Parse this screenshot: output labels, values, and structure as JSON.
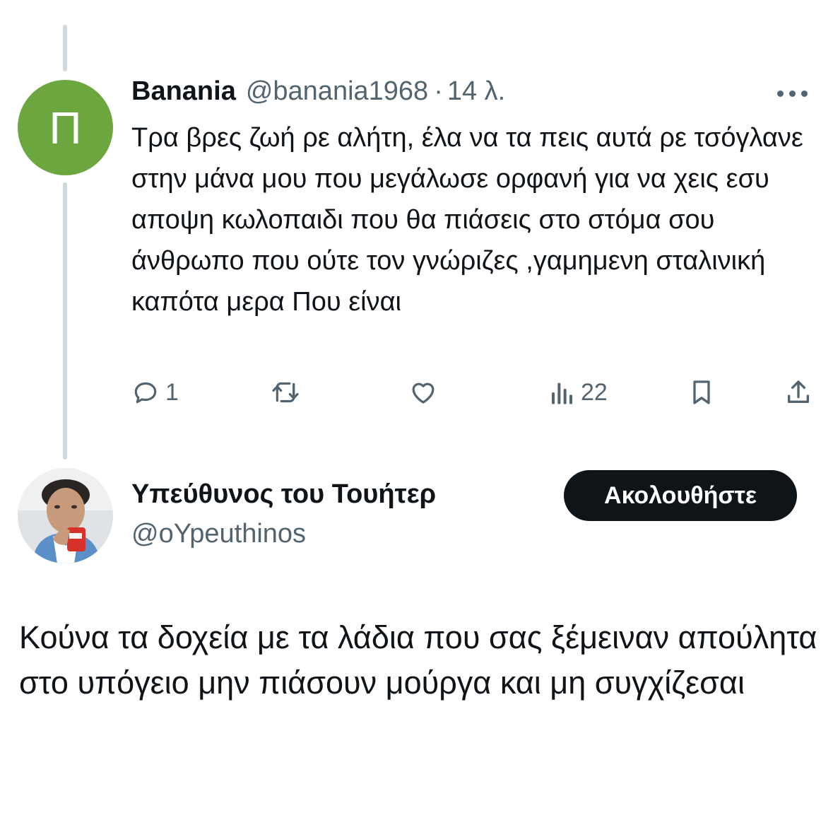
{
  "reply": {
    "avatar_letter": "Π",
    "name": "Banania",
    "handle": "@banania1968",
    "separator": "·",
    "time": "14 λ.",
    "text": "Τρα βρες ζωή ρε αλήτη, έλα να τα πεις αυτά ρε τσόγλανε στην μάνα μου που μεγάλωσε ορφανή για να χεις εσυ αποψη κωλοπαιδι που θα πιάσεις στο στόμα σου άνθρωπο που ούτε τον γνώριζες ,γαμημενη σταλινική καπότα μερα Που είναι",
    "actions": {
      "reply_count": "1",
      "views_count": "22"
    },
    "icons": [
      "reply-icon",
      "retweet-icon",
      "like-icon",
      "views-icon",
      "bookmark-icon",
      "share-icon",
      "more-icon"
    ]
  },
  "tweet": {
    "author_name": "Υπεύθυνος του Τουήτερ",
    "author_handle": "@oYpeuthinos",
    "follow_label": "Ακολουθήστε",
    "text": "Κούνα τα δοχεία με τα λάδια που σας ξέμειναν απούλητα στο υπόγειο μην πιάσουν μούργα και μη συγχίζεσαι"
  },
  "colors": {
    "avatar_green": "#6ba63f",
    "thread_line": "#cfd9de",
    "secondary_text": "#536471",
    "follow_button": "#0f1419"
  }
}
